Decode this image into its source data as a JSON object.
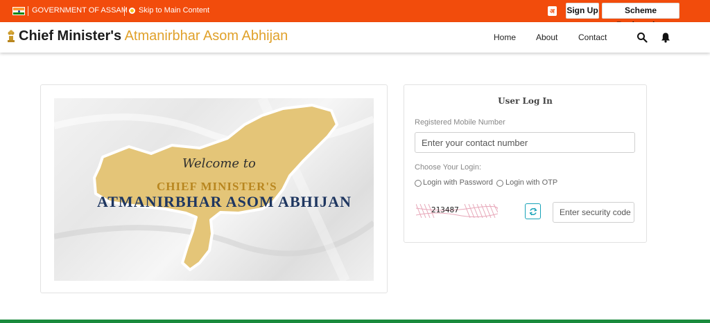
{
  "gov_bar": {
    "government_label": "GOVERNMENT OF ASSAM",
    "skip_link": "Skip to Main Content",
    "signup_label": "Sign Up",
    "scheme_registration_label": "Scheme Registration",
    "background_color": "#f24c0c"
  },
  "header": {
    "brand_part1": "Chief Minister's",
    "brand_part2": "Atmanirbhar Asom Abhijan",
    "nav": [
      "Home",
      "About",
      "Contact"
    ],
    "accent_color": "#e0a12a"
  },
  "banner": {
    "welcome_text": "Welcome to",
    "line1": "CHIEF MINISTER'S",
    "line2": "ATMANIRBHAR ASOM ABHIJAN"
  },
  "login": {
    "title": "User Log In",
    "mobile_label": "Registered Mobile Number",
    "mobile_placeholder": "Enter your contact number",
    "choose_label": "Choose Your Login:",
    "option_password": "Login with Password",
    "option_otp": "Login with OTP",
    "captcha_text": "213487",
    "security_placeholder": "Enter security code"
  },
  "icons": [
    "translate-icon",
    "search-icon",
    "bell-icon",
    "refresh-icon",
    "flag-icon",
    "emblem-icon"
  ],
  "footer": {
    "strip_color": "#198a3c"
  }
}
